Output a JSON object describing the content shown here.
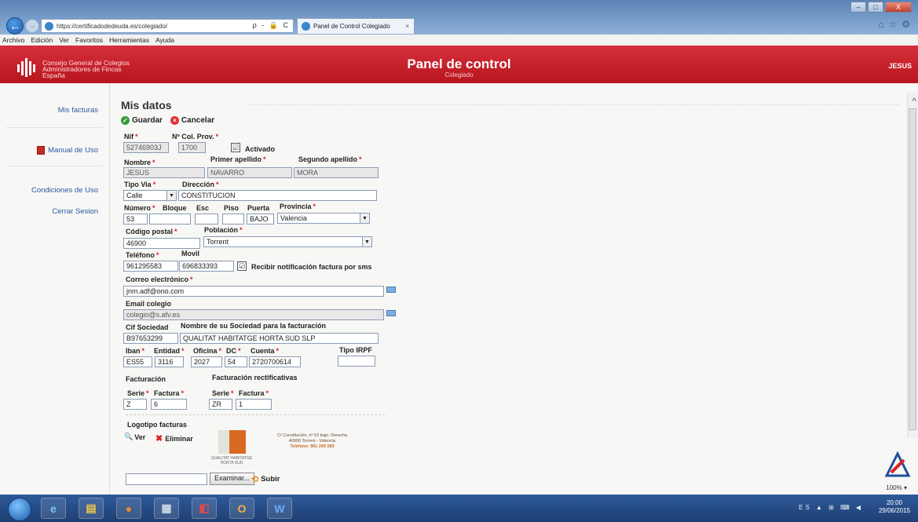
{
  "browser": {
    "url": "https://certificadodedeuda.es/colegiado/",
    "address_tools": "ρ - 🔒 C",
    "tab_title": "Panel de Control Colegiado",
    "tab_close": "×",
    "minimize": "–",
    "maximize": "□",
    "close": "X",
    "right_icons": [
      "⌂",
      "☆",
      "⚙"
    ]
  },
  "menubar": [
    "Archivo",
    "Edición",
    "Ver",
    "Favoritos",
    "Herramientas",
    "Ayuda"
  ],
  "header": {
    "org_line1": "Consejo General de Colegios",
    "org_line2": "Administradores de Fincas",
    "org_line3": "España",
    "title": "Panel de control",
    "subtitle": "Colegiado",
    "user": "JESUS"
  },
  "sidebar": {
    "items": [
      "Mis facturas",
      "Manual de Uso",
      "Condiciones de Uso",
      "Cerrar Sesion"
    ]
  },
  "main": {
    "title": "Mis datos",
    "save_label": "Guardar",
    "cancel_label": "Cancelar"
  },
  "form": {
    "nif_label": "Nif",
    "nif_value": "52746903J",
    "col_label": "Nº Col. Prov.",
    "col_value": "1700",
    "activado_label": "Activado",
    "nombre_label": "Nombre",
    "nombre_value": "JESUS",
    "apellido1_label": "Primer apellido",
    "apellido1_value": "NAVARRO",
    "apellido2_label": "Segundo apellido",
    "apellido2_value": "MORA",
    "tipovia_label": "Tipo Via",
    "tipovia_value": "Calle",
    "direccion_label": "Dirección",
    "direccion_value": "CONSTITUCION",
    "numero_label": "Número",
    "numero_value": "53",
    "bloque_label": "Bloque",
    "esc_label": "Esc",
    "piso_label": "Piso",
    "puerta_label": "Puerta",
    "puerta_value": "BAJO",
    "provincia_label": "Provincia",
    "provincia_value": "Valencia",
    "cp_label": "Código postal",
    "cp_value": "46900",
    "poblacion_label": "Población",
    "poblacion_value": "Torrent",
    "telefono_label": "Teléfono",
    "telefono_value": "961295583",
    "movil_label": "Movil",
    "movil_value": "696833393",
    "sms_label": "Recibir notificación factura por sms",
    "email_label": "Correo electrónico",
    "email_value": "jnm.adf@ono.com",
    "email_colegio_label": "Email colegio",
    "email_colegio_value": "colegio@s.afv.es",
    "cif_label": "Cif Sociedad",
    "cif_value": "B97653299",
    "sociedad_label": "Nombre de su Sociedad para la facturación",
    "sociedad_value": "QUALITAT HABITATGE HORTA SUD SLP",
    "iban_label": "Iban",
    "iban_value": "ES55",
    "entidad_label": "Entidad",
    "entidad_value": "3116",
    "oficina_label": "Oficina",
    "oficina_value": "2027",
    "dc_label": "DC",
    "dc_value": "54",
    "cuenta_label": "Cuenta",
    "cuenta_value": "2720700614",
    "irpf_label": "Tipo IRPF",
    "facturacion_label": "Facturación",
    "rectificativas_label": "Facturación rectificativas",
    "serie_label": "Serie",
    "factura_label": "Factura",
    "serie_value": "Z",
    "factura_value": "6",
    "serie_r_value": "ZR",
    "factura_r_value": "1",
    "logotipo_label": "Logotipo facturas",
    "ver_label": "Ver",
    "eliminar_label": "Eliminar",
    "logo_address_line1": "C/ Constitución, nº 53 bajo. Derecha",
    "logo_address_line2": "46900 Torrent - Valencia",
    "logo_phone": "Teléfono: 961 295 583",
    "browse_label": "Examinar...",
    "upload_label": "Subir",
    "required_mark": "*"
  },
  "status": {
    "zoom": "100%"
  },
  "taskbar": {
    "tray": "ES ▲ ⊞ ⌨ ◀",
    "time": "20:00",
    "date": "29/06/2015"
  },
  "colors": {
    "header_red": "#c41e28",
    "link_blue": "#2a5aa5",
    "required_red": "#dd2222"
  }
}
